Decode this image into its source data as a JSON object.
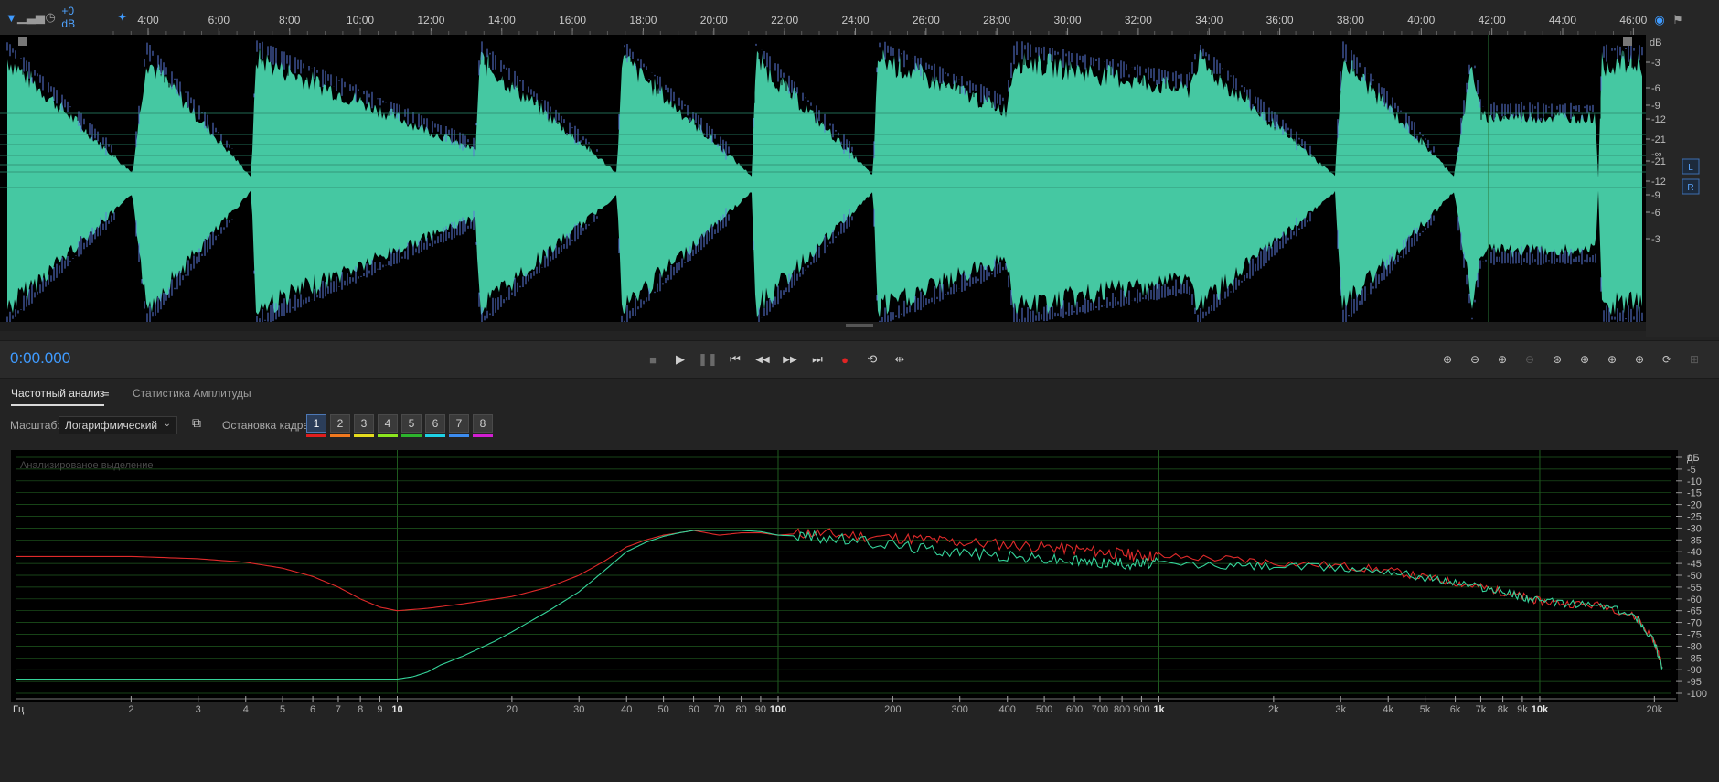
{
  "ruler": {
    "gain_label": "+0 dB",
    "time_labels": [
      "4:00",
      "6:00",
      "8:00",
      "10:00",
      "12:00",
      "14:00",
      "16:00",
      "18:00",
      "20:00",
      "22:00",
      "24:00",
      "26:00",
      "28:00",
      "30:00",
      "32:00",
      "34:00",
      "36:00",
      "38:00",
      "40:00",
      "42:00",
      "44:00",
      "46:00"
    ]
  },
  "waveform": {
    "db_unit": "dB",
    "db_labels_top": [
      "-3",
      "-6",
      "-9",
      "-12",
      "-21"
    ],
    "inf_label": "-∞",
    "db_labels_bottom": [
      "-21",
      "-12",
      "-9",
      "-6",
      "-3"
    ],
    "channel_labels": [
      "L",
      "R"
    ],
    "colors": {
      "wave": "#45c8a2",
      "peaks": "#5a78d8",
      "background": "#000000"
    }
  },
  "transport": {
    "time": "0:00.000",
    "buttons": [
      "stop-icon",
      "play-icon",
      "pause-icon",
      "skip-start-icon",
      "rewind-icon",
      "fast-forward-icon",
      "skip-end-icon",
      "record-icon",
      "loop-icon",
      "skip-selection-icon"
    ],
    "zoom_buttons": [
      "zoom-in-amplitude-icon",
      "zoom-out-amplitude-icon",
      "zoom-in-time-icon",
      "zoom-out-time-icon",
      "zoom-full-icon",
      "zoom-in-left-icon",
      "zoom-in-right-icon",
      "zoom-selection-icon",
      "zoom-reset-icon",
      "zoom-track-icon"
    ]
  },
  "panel": {
    "tabs": [
      {
        "label": "Частотный анализ",
        "active": true
      },
      {
        "label": "Статистика Амплитуды",
        "active": false
      }
    ],
    "scale_label": "Масштаб:",
    "scale_value": "Логарифмический",
    "freeze_label": "Остановка кадра:",
    "frames": [
      "1",
      "2",
      "3",
      "4",
      "5",
      "6",
      "7",
      "8"
    ],
    "frame_colors": [
      "#e01e1e",
      "#f0781e",
      "#e6dc1e",
      "#8ce61e",
      "#2db42d",
      "#1ed2e6",
      "#3c8cf0",
      "#d21ed2"
    ],
    "selected_frame": "1"
  },
  "chart_data": {
    "type": "line",
    "title": "Анализированое выделение",
    "xscale": "log",
    "xlim": [
      1,
      22050
    ],
    "ylim": [
      -100,
      0
    ],
    "yunit": "дБ",
    "xunit": "Гц",
    "x_tick_labels": [
      "2",
      "3",
      "4",
      "5",
      "6",
      "7",
      "8",
      "9",
      "10",
      "20",
      "30",
      "40",
      "50",
      "60",
      "70",
      "80",
      "90",
      "100",
      "200",
      "300",
      "400",
      "500",
      "600",
      "700",
      "800",
      "900",
      "1k",
      "2k",
      "3k",
      "4k",
      "5k",
      "6k",
      "7k",
      "8k",
      "9k",
      "10k",
      "20k"
    ],
    "y_tick_labels": [
      "0",
      "-5",
      "-10",
      "-15",
      "-20",
      "-25",
      "-30",
      "-35",
      "-40",
      "-45",
      "-50",
      "-55",
      "-60",
      "-65",
      "-70",
      "-75",
      "-80",
      "-85",
      "-90",
      "-95",
      "-100"
    ],
    "series": [
      {
        "color": "#e02a2a",
        "x": [
          1,
          2,
          3,
          4,
          5,
          6,
          7,
          8,
          9,
          10,
          12,
          15,
          20,
          25,
          30,
          35,
          40,
          45,
          50,
          55,
          60,
          70,
          80,
          90,
          100,
          120,
          150,
          200,
          250,
          300,
          400,
          500,
          600,
          700,
          800,
          900,
          1000,
          1500,
          2000,
          3000,
          4000,
          5000,
          6000,
          7000,
          8000,
          9000,
          10000,
          12000,
          15000,
          18000,
          20000,
          21000
        ],
        "y": [
          -42,
          -42,
          -43,
          -44.5,
          -47,
          -50.5,
          -55,
          -60,
          -63.5,
          -65,
          -64,
          -62,
          -59,
          -55,
          -50,
          -44,
          -38,
          -35,
          -33,
          -32,
          -31,
          -33,
          -32,
          -32,
          -33,
          -32,
          -33,
          -34,
          -35,
          -36,
          -37,
          -38,
          -39,
          -40,
          -41,
          -41.5,
          -42,
          -43,
          -44.5,
          -46,
          -48,
          -51,
          -53,
          -55,
          -57,
          -59,
          -61,
          -62,
          -63,
          -68,
          -78,
          -89
        ]
      },
      {
        "color": "#35d39a",
        "x": [
          1,
          5,
          9,
          10,
          11,
          12,
          13,
          15,
          18,
          20,
          25,
          30,
          35,
          40,
          45,
          50,
          55,
          60,
          70,
          80,
          90,
          100,
          120,
          150,
          200,
          250,
          300,
          400,
          500,
          600,
          700,
          800,
          900,
          1000,
          1500,
          2000,
          3000,
          4000,
          5000,
          6000,
          7000,
          8000,
          9000,
          10000,
          12000,
          15000,
          18000,
          20000,
          21000
        ],
        "y": [
          -94,
          -94,
          -94,
          -94,
          -93,
          -91,
          -88,
          -84,
          -78,
          -74,
          -65,
          -57,
          -48,
          -40,
          -36,
          -33.5,
          -32,
          -31,
          -31,
          -31,
          -31.5,
          -33,
          -33.5,
          -35,
          -37,
          -39,
          -40,
          -42,
          -43,
          -44,
          -44.5,
          -45,
          -45,
          -45,
          -46,
          -46,
          -47,
          -48,
          -51,
          -53,
          -55,
          -57,
          -59,
          -61,
          -62,
          -63,
          -68,
          -78,
          -89
        ]
      }
    ]
  }
}
